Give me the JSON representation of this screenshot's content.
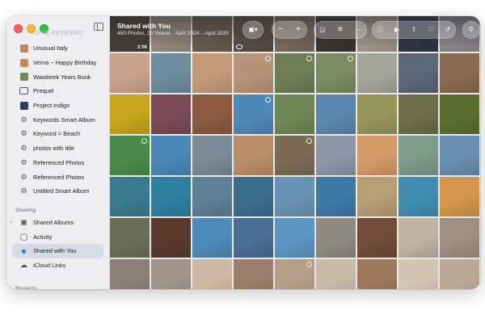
{
  "sidebar": {
    "faded_header": "To Be Reviewed",
    "items": [
      {
        "label": "Unusual Italy",
        "icon": "album-thumbnail-icon",
        "color": "#b5896a"
      },
      {
        "label": "Verna ~ Happy Birthday",
        "icon": "album-thumbnail-icon",
        "color": "#c8895a"
      },
      {
        "label": "Wawbeek Years Book",
        "icon": "album-thumbnail-icon",
        "color": "#6f8a5a"
      },
      {
        "label": "Prequel",
        "icon": "album-icon"
      },
      {
        "label": "Project Indigo",
        "icon": "album-thumbnail-icon",
        "color": "#2f3d63"
      },
      {
        "label": "Keywords Smart Album",
        "icon": "smart-album-gear-icon"
      },
      {
        "label": "Keyword = Beach",
        "icon": "smart-album-gear-icon"
      },
      {
        "label": "photos with title",
        "icon": "smart-album-gear-icon"
      },
      {
        "label": "Referenced Photos",
        "icon": "smart-album-gear-icon"
      },
      {
        "label": "Referenced Photos",
        "icon": "smart-album-gear-icon"
      },
      {
        "label": "Untitled Smart Album",
        "icon": "smart-album-gear-icon"
      }
    ],
    "sharing_header": "Sharing",
    "sharing_items": [
      {
        "label": "Shared Albums",
        "icon": "shared-albums-icon"
      },
      {
        "label": "Activity",
        "icon": "activity-icon"
      },
      {
        "label": "Shared with You",
        "icon": "shared-with-you-icon",
        "selected": true
      },
      {
        "label": "iCloud Links",
        "icon": "icloud-link-icon"
      }
    ],
    "projects_header": "Projects"
  },
  "toolbar": {
    "title": "Shared with You",
    "subtitle": "450 Photos, 25 Videos · April 2024 – April 2025",
    "buttons": [
      "view-options-icon",
      "zoom-out-icon",
      "zoom-in-icon",
      "slideshow-icon",
      "filter-icon",
      "more-icon",
      "info-icon",
      "play-icon",
      "share-icon",
      "favorite-icon",
      "rotate-icon",
      "search-icon"
    ]
  },
  "grid": {
    "video_duration": "2:06",
    "photos": [
      [
        "#4a4038",
        "#9a8c7f",
        "#6a5e50",
        "#5a4f45",
        "#7b6b5e",
        "#3c3633",
        "#a59b8e",
        "#2e3844",
        "#8c8a8f"
      ],
      [
        "#c9a28d",
        "#6d8c9f",
        "#c29a7a",
        "#b79478",
        "#6f7d55",
        "#7c8a62",
        "#a5a69a",
        "#5b6677",
        "#8a6a50"
      ],
      [
        "#c6a41c",
        "#7a4a57",
        "#8c5a40",
        "#4f89b8",
        "#6f8756",
        "#5a87ad",
        "#97955a",
        "#6a6f48",
        "#5a6e30"
      ],
      [
        "#4c8a4b",
        "#4a88b8",
        "#7a8a96",
        "#ba8e68",
        "#7a6b55",
        "#8d96a6",
        "#d39a68",
        "#7d9a8a",
        "#6a8eb0"
      ],
      [
        "#3b7a8e",
        "#2f7fa0",
        "#5e7f96",
        "#3c6e8c",
        "#6a92b4",
        "#3e7aa6",
        "#b79e74",
        "#3f8eb2",
        "#d3964c"
      ],
      [
        "#6a6e58",
        "#5a3a2e",
        "#4e8aba",
        "#4a6e96",
        "#5e95c2",
        "#908a80",
        "#704c38",
        "#c0b3a3",
        "#a08e80"
      ],
      [
        "#8a8078",
        "#a09488",
        "#cdb8a5",
        "#9a7e6a",
        "#b39e88",
        "#c8baa8",
        "#9c785c",
        "#d5c6b4",
        "#bba996"
      ]
    ],
    "overlays": {
      "0": "video",
      "3": "chat",
      "12": "dot",
      "13": "dot",
      "14": "dot",
      "21": "dot",
      "27": "dot",
      "31": "dot",
      "58": "dot",
      "61": "chat",
      "66": "dot",
      "67": "chat"
    }
  }
}
